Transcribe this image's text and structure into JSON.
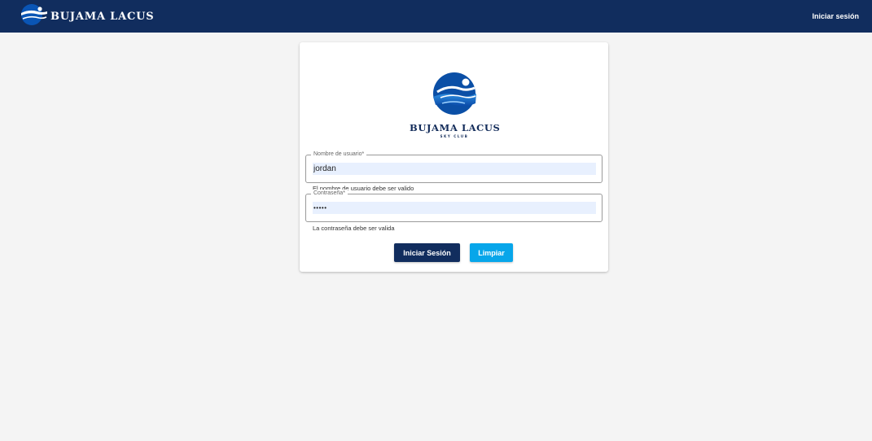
{
  "header": {
    "brand_name": "BUJAMA LACUS",
    "login_link": "Iniciar sesión"
  },
  "card": {
    "logo_name": "BUJAMA LACUS",
    "logo_subtitle": "SKY CLUB",
    "username": {
      "label": "Nombre de usuario*",
      "value": "jordan",
      "helper": "El nombre de usuario debe ser valido"
    },
    "password": {
      "label": "Contraseña*",
      "value": "•••••",
      "helper": "La contraseña debe ser valida"
    },
    "buttons": {
      "login": "Iniciar Sesión",
      "clear": "Limpiar"
    }
  },
  "colors": {
    "navbar": "#112d5e",
    "primary_button": "#112d5e",
    "secondary_button": "#07a6ea",
    "autofill_bg": "#e8f0fe"
  },
  "icons": {
    "brand": "swimmer-logo-icon",
    "card_logo": "swimmer-emblem-icon"
  }
}
